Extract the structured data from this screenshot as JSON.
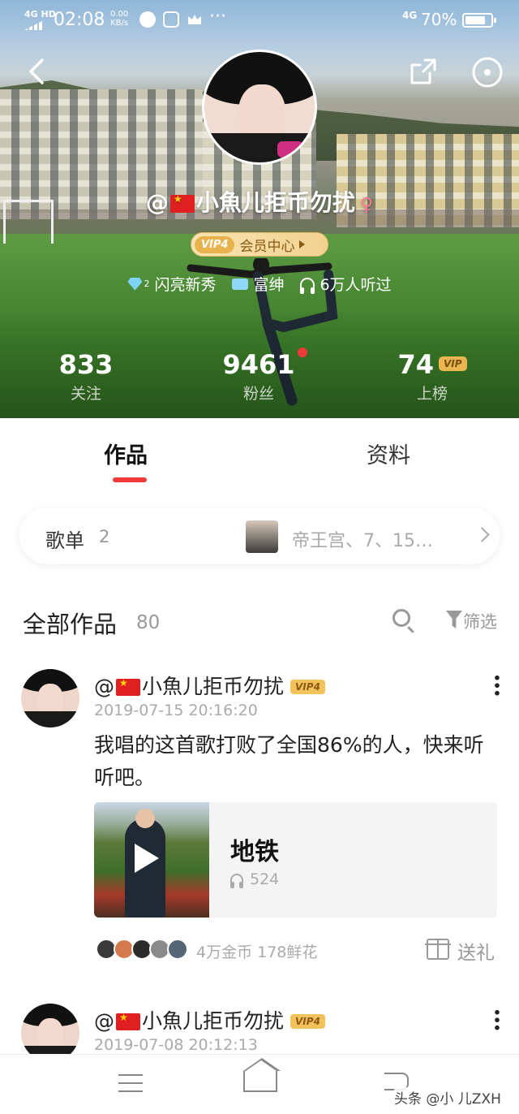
{
  "status_bar": {
    "network": "4G HD",
    "time": "02:08",
    "speed_value": "0.00",
    "speed_unit": "KB/s",
    "network_right": "4G",
    "battery": "70%"
  },
  "profile": {
    "nickname_prefix": "@",
    "nickname": "小魚儿拒币勿扰",
    "vip_level": "VIP4",
    "vip_center": "会员中心",
    "badges": {
      "diamond_level": "2",
      "shine_label": "闪亮新秀",
      "rich_label": "富绅",
      "listened": "6万人听过"
    },
    "stats": {
      "follow_count": "833",
      "follow_label": "关注",
      "fans_count": "9461",
      "fans_label": "粉丝",
      "rank_count": "74",
      "rank_vip": "VIP",
      "rank_label": "上榜"
    }
  },
  "tabs": {
    "works": "作品",
    "info": "资料"
  },
  "playlist": {
    "label": "歌单",
    "count": "2",
    "songs": "帝王宫、7、15…"
  },
  "works_header": {
    "title": "全部作品",
    "count": "80",
    "filter": "筛选"
  },
  "posts": [
    {
      "author_prefix": "@",
      "author": "小魚儿拒币勿扰",
      "vip": "VIP4",
      "time": "2019-07-15 20:16:20",
      "text": "我唱的这首歌打败了全国86%的人，快来听听吧。",
      "song_title": "地铁",
      "song_plays": "524",
      "gift_stats": "4万金币  178鲜花",
      "gift_label": "送礼"
    },
    {
      "author_prefix": "@",
      "author": "小魚儿拒币勿扰",
      "vip": "VIP4",
      "time": "2019-07-08 20:12:13"
    }
  ],
  "watermark": "头条 @小   儿ZXH"
}
